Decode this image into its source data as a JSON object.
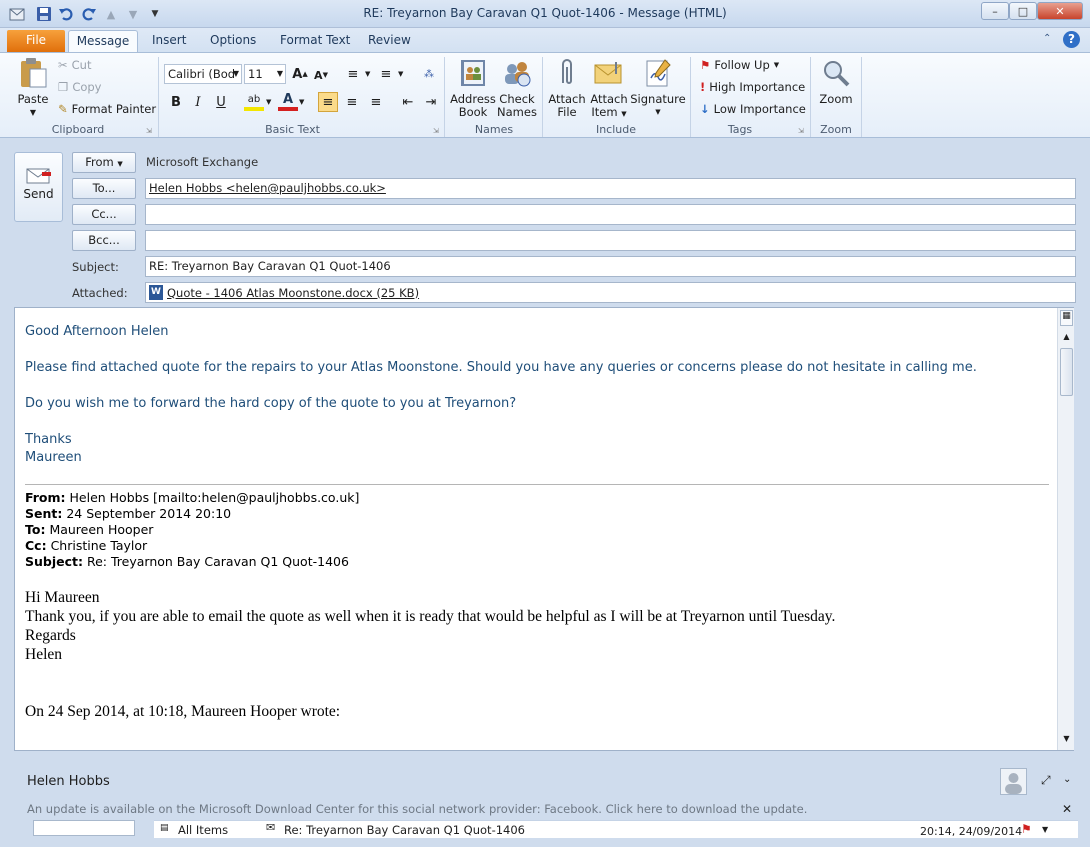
{
  "window": {
    "title": "RE: Treyarnon Bay Caravan Q1  Quot-1406  -  Message (HTML)"
  },
  "tabs": [
    "File",
    "Message",
    "Insert",
    "Options",
    "Format Text",
    "Review"
  ],
  "ribbon": {
    "clipboard": {
      "paste": "Paste",
      "cut": "Cut",
      "copy": "Copy",
      "format_painter": "Format Painter",
      "label": "Clipboard"
    },
    "basic_text": {
      "font": "Calibri (Bod",
      "size": "11",
      "label": "Basic Text"
    },
    "names": {
      "address_book": [
        "Address",
        "Book"
      ],
      "check_names": [
        "Check",
        "Names"
      ],
      "label": "Names"
    },
    "include": {
      "attach_file": [
        "Attach",
        "File"
      ],
      "attach_item": [
        "Attach",
        "Item"
      ],
      "signature": "Signature",
      "label": "Include"
    },
    "tags": {
      "follow_up": "Follow Up",
      "high": "High Importance",
      "low": "Low Importance",
      "label": "Tags"
    },
    "zoom": {
      "zoom": "Zoom",
      "label": "Zoom"
    }
  },
  "compose": {
    "send": "Send",
    "from_btn": "From",
    "from_value": "Microsoft Exchange",
    "to_btn": "To...",
    "to_value": "Helen Hobbs <helen@pauljhobbs.co.uk>",
    "cc_btn": "Cc...",
    "bcc_btn": "Bcc...",
    "subject_label": "Subject:",
    "subject_value": "RE: Treyarnon Bay Caravan Q1  Quot-1406",
    "attached_label": "Attached:",
    "attachment": "Quote - 1406  Atlas Moonstone.docx (25 KB)"
  },
  "body": {
    "greeting": "Good Afternoon Helen",
    "line1": "Please find attached quote for the repairs to your Atlas Moonstone.  Should you have any queries or concerns please do not hesitate in calling me.",
    "line2": "Do you wish me to forward the hard copy of the quote to you at Treyarnon?",
    "thanks": "Thanks",
    "name": "Maureen",
    "quoted": {
      "from_label": "From:",
      "from": "Helen Hobbs [mailto:helen@pauljhobbs.co.uk]",
      "sent_label": "Sent:",
      "sent": "24 September 2014 20:10",
      "to_label": "To:",
      "to": "Maureen Hooper",
      "cc_label": "Cc:",
      "cc": "Christine Taylor",
      "subject_label": "Subject:",
      "subject": "Re: Treyarnon Bay Caravan Q1 Quot-1406",
      "hi": "Hi Maureen",
      "text": "Thank you, if you are able to email the quote as well when it is ready that would be helpful as I will be at Treyarnon until Tuesday.",
      "regards": "Regards",
      "sign": "Helen",
      "wrote": "On 24 Sep 2014, at 10:18, Maureen Hooper wrote:"
    }
  },
  "people_pane": {
    "name": "Helen Hobbs",
    "update": "An update is available on the Microsoft Download Center for this social network provider: Facebook. Click here to download the update.",
    "all_items": "All Items",
    "item_subject": "Re: Treyarnon Bay Caravan Q1 Quot-1406",
    "item_time": "20:14, 24/09/2014"
  }
}
